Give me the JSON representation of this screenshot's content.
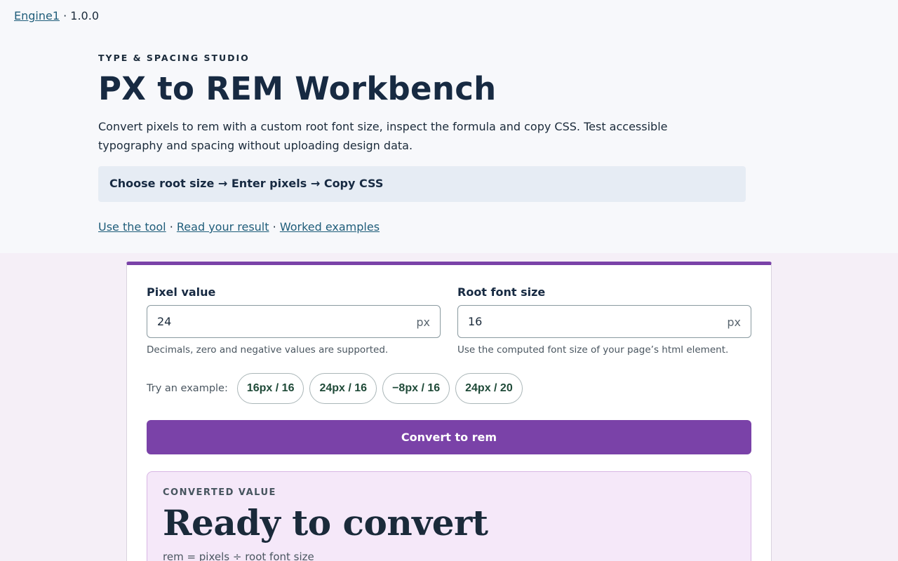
{
  "header": {
    "brand_link": "Engine1",
    "version": "· 1.0.0"
  },
  "hero": {
    "eyebrow": "TYPE & SPACING STUDIO",
    "title": "PX to REM Workbench",
    "description": "Convert pixels to rem with a custom root font size, inspect the formula and copy CSS. Test accessible typography and spacing without uploading design data.",
    "steps": "Choose root size → Enter pixels → Copy CSS",
    "links": [
      {
        "label": "Use the tool"
      },
      {
        "label": "Read your result"
      },
      {
        "label": "Worked examples"
      }
    ],
    "link_separator": "·"
  },
  "tool": {
    "pixel": {
      "label": "Pixel value",
      "value": "24",
      "unit": "px",
      "hint": "Decimals, zero and negative values are supported."
    },
    "root": {
      "label": "Root font size",
      "value": "16",
      "unit": "px",
      "hint": "Use the computed font size of your page’s html element."
    },
    "examples_label": "Try an example:",
    "examples": [
      {
        "label": "16px / 16"
      },
      {
        "label": "24px / 16"
      },
      {
        "label": "−8px / 16"
      },
      {
        "label": "24px / 20"
      }
    ],
    "convert_label": "Convert to rem",
    "result": {
      "kicker": "CONVERTED VALUE",
      "value": "Ready to convert",
      "formula": "rem = pixels ÷ root font size"
    }
  },
  "colors": {
    "accent": "#7a42a8",
    "link": "#1f5d7a",
    "result_bg": "#f5e8f9"
  }
}
